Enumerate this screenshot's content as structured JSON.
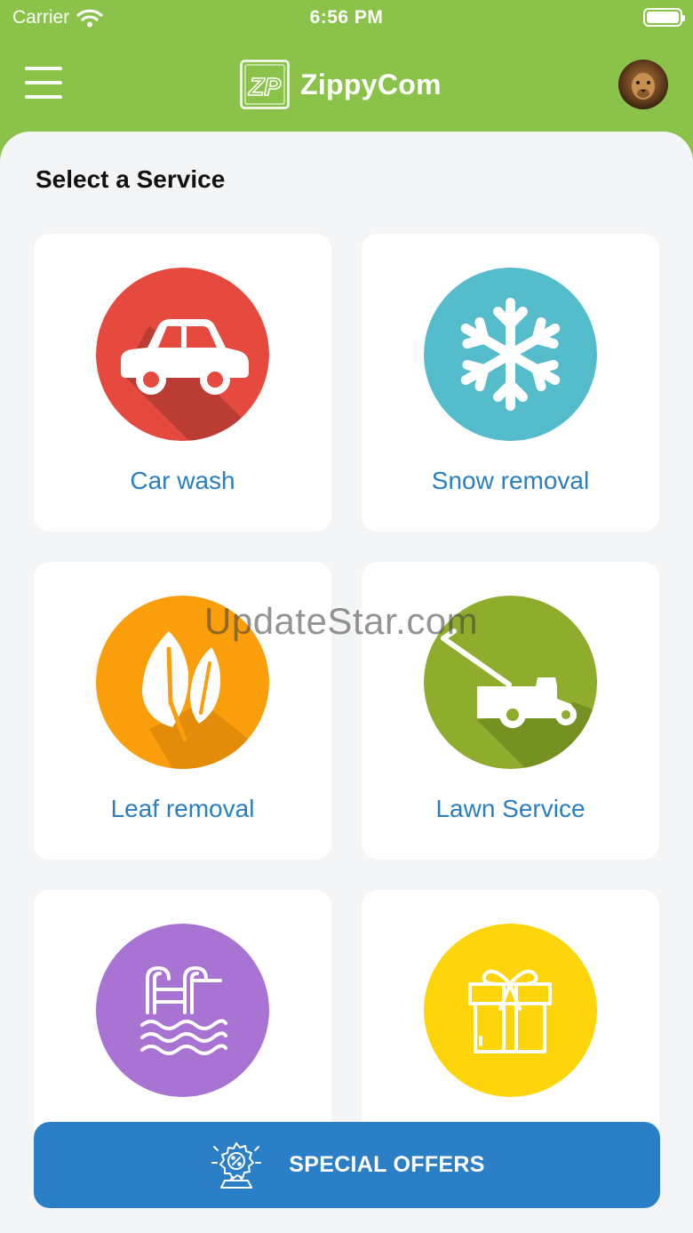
{
  "status_bar": {
    "carrier": "Carrier",
    "time": "6:56 PM"
  },
  "header": {
    "app_name": "ZippyCom",
    "logo_letters": "ZP"
  },
  "main": {
    "title": "Select a Service",
    "services": [
      {
        "label": "Car wash",
        "icon": "car-icon",
        "color": "#e64a3e"
      },
      {
        "label": "Snow removal",
        "icon": "snowflake-icon",
        "color": "#55bccb"
      },
      {
        "label": "Leaf removal",
        "icon": "leaf-icon",
        "color": "#fb9e0b"
      },
      {
        "label": "Lawn Service",
        "icon": "lawn-mower-icon",
        "color": "#8fad2d"
      },
      {
        "label": "",
        "icon": "pool-icon",
        "color": "#a873d3"
      },
      {
        "label": "",
        "icon": "gift-icon",
        "color": "#fdd50a"
      }
    ]
  },
  "watermark": "UpdateStar.com",
  "special_offers": {
    "label": "SPECIAL OFFERS",
    "icon": "discount-badge-icon"
  },
  "colors": {
    "brand_green": "#8bc34a",
    "accent_blue": "#2a7fc6",
    "label_blue": "#2a7fc1"
  }
}
